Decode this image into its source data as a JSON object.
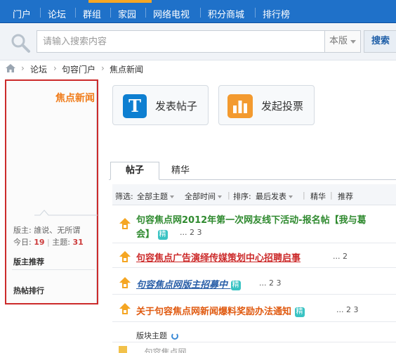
{
  "nav": {
    "items": [
      "门户",
      "论坛",
      "群组",
      "家园",
      "网络电视",
      "积分商城",
      "排行榜"
    ]
  },
  "search": {
    "placeholder": "请输入搜索内容",
    "scope": "本版",
    "button": "搜索"
  },
  "breadcrumb": [
    "论坛",
    "句容门户",
    "焦点新闻"
  ],
  "sidebar": {
    "title": "焦点新闻",
    "moderators": "版主: 誰说、无所谓",
    "today_label": "今日:",
    "today_value": "19",
    "topics_label": "主题:",
    "topics_value": "31",
    "section_moderator_rec": "版主推荐",
    "section_hot": "热帖排行"
  },
  "actions": {
    "post": "发表帖子",
    "poll": "发起投票"
  },
  "tabs": [
    "帖子",
    "精华"
  ],
  "filters": {
    "filter_label": "筛选:",
    "all_topics": "全部主题",
    "all_time": "全部时间",
    "sort_label": "排序:",
    "sort_value": "最后发表",
    "digest": "精华",
    "recommend": "推荐"
  },
  "threads": [
    {
      "title_line1": "句容焦点网2012年第一次网友线下活动-报名帖【我与葛",
      "title_line2": "会】",
      "badge": "精",
      "pages": "... 2  3"
    },
    {
      "title": "句容焦点广告演绎传媒策划中心招聘启事",
      "pages": "... 2"
    },
    {
      "title": "句容焦点网版主招募中",
      "badge": "精",
      "pages": "... 2  3"
    },
    {
      "title": "关于句容焦点网新闻爆料奖励办法通知",
      "badge": "精",
      "pages": "... 2  3"
    }
  ],
  "board_subtopics": "版块主题",
  "partial_row": "...句容焦点网..."
}
